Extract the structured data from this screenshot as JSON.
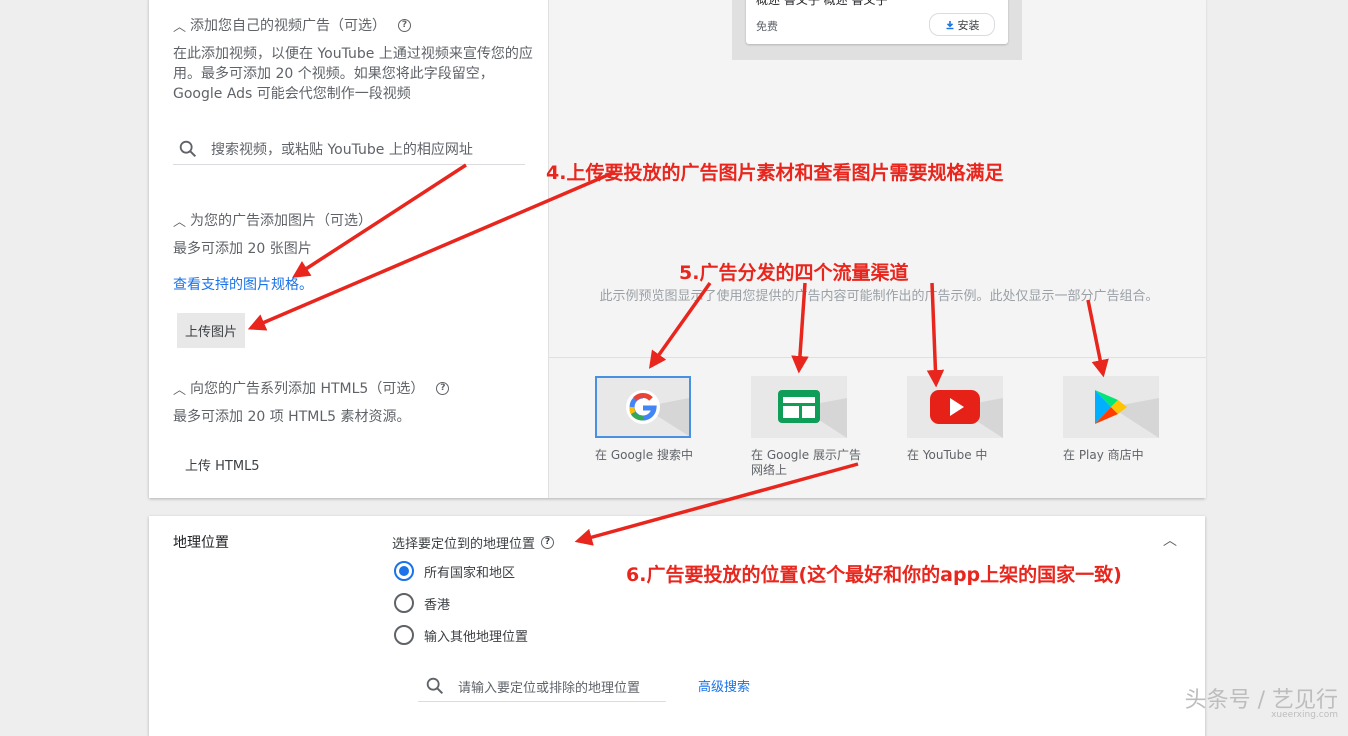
{
  "video_section": {
    "title": "添加您自己的视频广告（可选）",
    "description": "在此添加视频，以便在 YouTube 上通过视频来宣传您的应用。最多可添加 20 个视频。如果您将此字段留空，Google Ads 可能会代您制作一段视频",
    "search_placeholder": "搜索视频，或粘贴 YouTube 上的相应网址"
  },
  "image_section": {
    "title": "为您的广告添加图片（可选）",
    "description": "最多可添加 20 张图片",
    "spec_link": "查看支持的图片规格。",
    "upload_button": "上传图片"
  },
  "html5_section": {
    "title": "向您的广告系列添加 HTML5（可选）",
    "description": "最多可添加 20 项 HTML5 素材资源。",
    "upload_button": "上传 HTML5"
  },
  "preview": {
    "app_line": "概述  鲁父子 概述  鲁父子",
    "price": "免费",
    "install_button": "安装",
    "note": "此示例预览图显示了使用您提供的广告内容可能制作出的广告示例。此处仅显示一部分广告组合。",
    "channels": [
      {
        "label": "在 Google 搜索中",
        "icon": "google-g-icon"
      },
      {
        "label": "在 Google 展示广告网络上",
        "icon": "display-network-icon"
      },
      {
        "label": "在 YouTube 中",
        "icon": "youtube-icon"
      },
      {
        "label": "在 Play 商店中",
        "icon": "play-store-icon"
      }
    ]
  },
  "geo": {
    "title": "地理位置",
    "prompt": "选择要定位到的地理位置",
    "options": [
      {
        "label": "所有国家和地区",
        "selected": true
      },
      {
        "label": "香港",
        "selected": false
      },
      {
        "label": "输入其他地理位置",
        "selected": false
      }
    ],
    "search_placeholder": "请输入要定位或排除的地理位置",
    "advanced_link": "高级搜索"
  },
  "annotations": {
    "a4": "4.上传要投放的广告图片素材和查看图片需要规格满足",
    "a5": "5.广告分发的四个流量渠道",
    "a6": "6.广告要投放的位置(这个最好和你的app上架的国家一致)"
  },
  "watermark": {
    "main": "头条号 / 艺见行",
    "sub": "xueerxing.com"
  },
  "colors": {
    "accent": "#1a73e8",
    "annotation_red": "#e8261d",
    "youtube_red": "#e62117",
    "display_green": "#0f9d58"
  }
}
